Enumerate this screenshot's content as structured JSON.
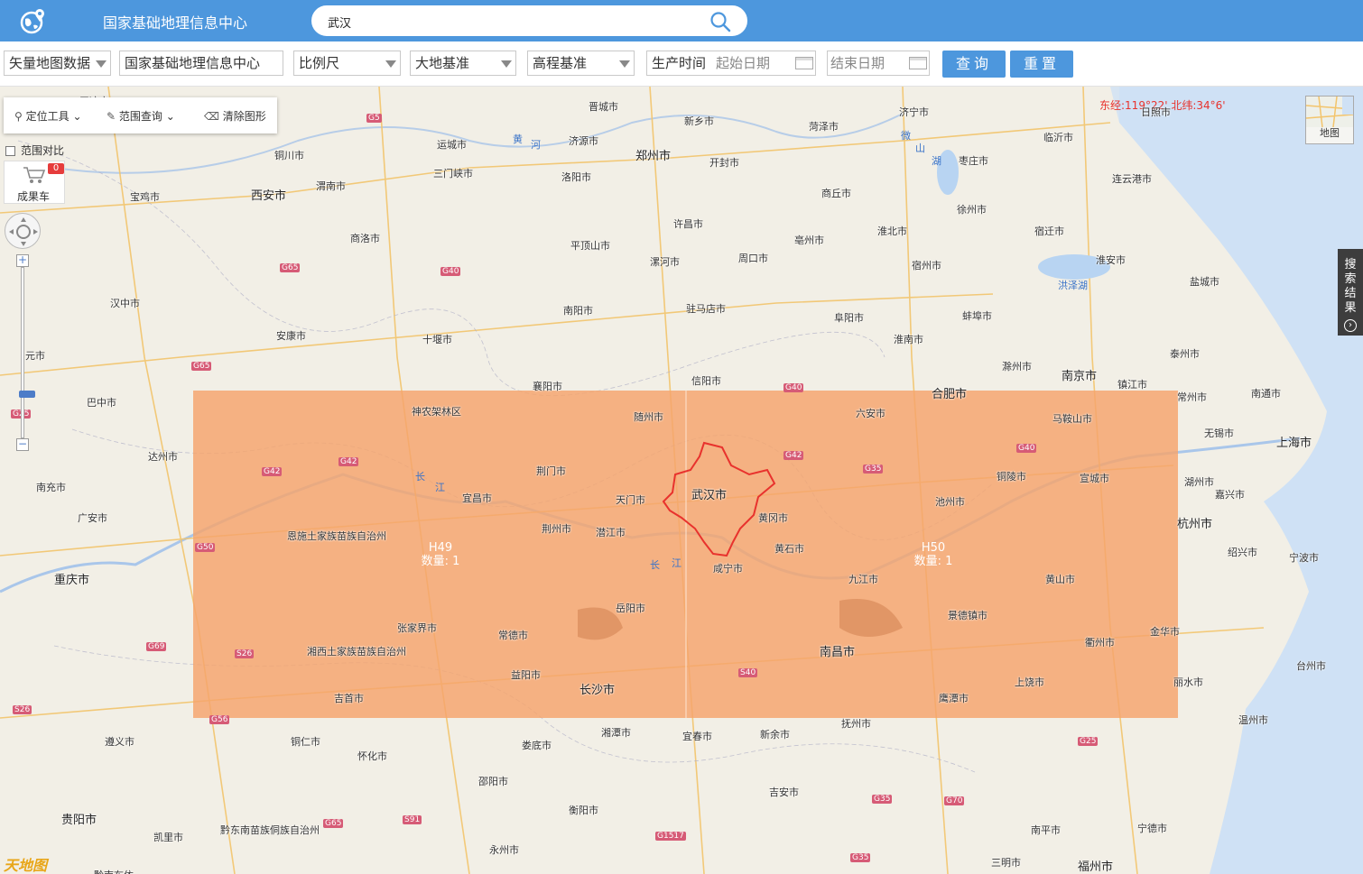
{
  "header": {
    "title": "国家基础地理信息中心",
    "search_value": "武汉"
  },
  "filters": {
    "data_type": "矢量地图数据",
    "producer": "国家基础地理信息中心",
    "scale": "比例尺",
    "geodetic_datum": "大地基准",
    "height_datum": "高程基准",
    "production_time_label": "生产时间",
    "start_date_placeholder": "起始日期",
    "end_date_placeholder": "结束日期",
    "query_label": "查询",
    "reset_label": "重置"
  },
  "map_ui": {
    "coordinate_readout": "东经:119°22' 北纬:34°6'",
    "locate_tool": "定位工具",
    "range_query": "范围查询",
    "clear_shapes": "清除图形",
    "range_compare": "范围对比",
    "cart_label": "成果车",
    "cart_count": "0",
    "minimap_label": "地图",
    "search_results_tab": "搜索结果",
    "provider_logo": "天地图"
  },
  "tiles": [
    {
      "name": "H49",
      "count_text": "数量: 1"
    },
    {
      "name": "H50",
      "count_text": "数量: 1"
    }
  ],
  "colors": {
    "header_bg": "#4d97dd",
    "tile_fill": "#f5a46b",
    "boundary": "#e8322d",
    "coord_text": "#e8322d"
  },
  "map_labels": {
    "cities": [
      "平凉市",
      "晋城市",
      "新乡市",
      "菏泽市",
      "济宁市",
      "日照市",
      "运城市",
      "济源市",
      "郑州市",
      "开封市",
      "临沂市",
      "铜川市",
      "三门峡市",
      "洛阳市",
      "枣庄市",
      "宝鸡市",
      "西安市",
      "渭南市",
      "商丘市",
      "连云港市",
      "许昌市",
      "徐州市",
      "商洛市",
      "平顶山市",
      "亳州市",
      "淮北市",
      "宿迁市",
      "漯河市",
      "周口市",
      "宿州市",
      "淮安市",
      "汉中市",
      "南阳市",
      "驻马店市",
      "盐城市",
      "阜阳市",
      "蚌埠市",
      "安康市",
      "十堰市",
      "元市",
      "淮南市",
      "滁州市",
      "泰州市",
      "襄阳市",
      "信阳市",
      "南京市",
      "镇江市",
      "巴中市",
      "合肥市",
      "常州市",
      "南通市",
      "神农架林区",
      "随州市",
      "六安市",
      "马鞍山市",
      "无锡市",
      "上海市",
      "达州市",
      "荆门市",
      "铜陵市",
      "宣城市",
      "湖州市",
      "宜昌市",
      "天门市",
      "武汉市",
      "池州市",
      "嘉兴市",
      "南充市",
      "广安市",
      "荆州市",
      "潜江市",
      "黄冈市",
      "杭州市",
      "恩施土家族苗族自治州",
      "黄石市",
      "绍兴市",
      "宁波市",
      "重庆市",
      "咸宁市",
      "九江市",
      "黄山市",
      "岳阳市",
      "张家界市",
      "常德市",
      "景德镇市",
      "金华市",
      "衢州市",
      "湘西土家族苗族自治州",
      "益阳市",
      "南昌市",
      "台州市",
      "长沙市",
      "上饶市",
      "丽水市",
      "吉首市",
      "鹰潭市",
      "温州市",
      "抚州市",
      "湘潭市",
      "宜春市",
      "新余市",
      "遵义市",
      "铜仁市",
      "娄底市",
      "怀化市",
      "邵阳市",
      "吉安市",
      "贵阳市",
      "衡阳市",
      "南平市",
      "宁德市",
      "凯里市",
      "黔东南苗族侗族自治州",
      "永州市",
      "三明市",
      "福州市",
      "黔南布依"
    ],
    "waters": [
      "黄",
      "河",
      "微",
      "山",
      "湖",
      "洪泽湖",
      "长",
      "江",
      "长",
      "江"
    ],
    "highways": [
      "G5",
      "G65",
      "G40",
      "G65",
      "G25",
      "G42",
      "G42",
      "G50",
      "G69",
      "S26",
      "G56",
      "S26",
      "G40",
      "G42",
      "G35",
      "G40",
      "S40",
      "G25",
      "G35",
      "G70",
      "G65",
      "S91",
      "G1517",
      "G35"
    ]
  }
}
